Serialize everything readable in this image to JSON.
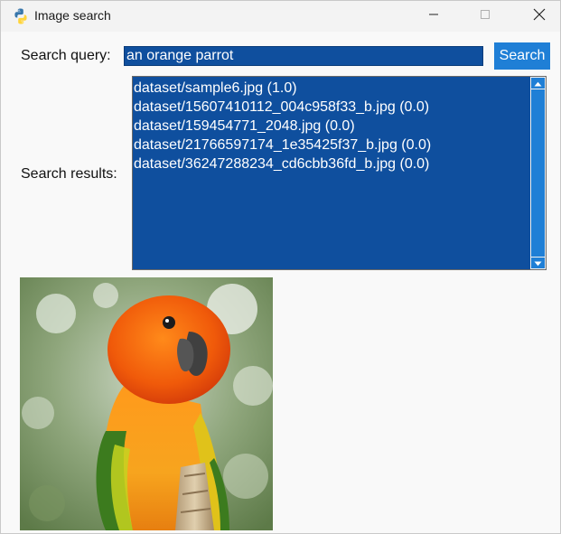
{
  "window": {
    "title": "Image search",
    "app_icon": "python-icon",
    "controls": [
      "minimize-icon",
      "maximize-icon",
      "close-icon"
    ]
  },
  "form": {
    "query_label": "Search query:",
    "query_value": "an orange parrot",
    "search_button": "Search",
    "results_label": "Search results:"
  },
  "results": [
    "dataset/sample6.jpg (1.0)",
    "dataset/15607410112_004c958f33_b.jpg (0.0)",
    "dataset/159454771_2048.jpg (0.0)",
    "dataset/21766597174_1e35425f37_b.jpg (0.0)",
    "dataset/36247288234_cd6cbb36fd_b.jpg (0.0)"
  ],
  "colors": {
    "selection_blue": "#0f4f9e",
    "button_blue": "#1f7fd6",
    "window_bg": "#f9f9f9"
  }
}
